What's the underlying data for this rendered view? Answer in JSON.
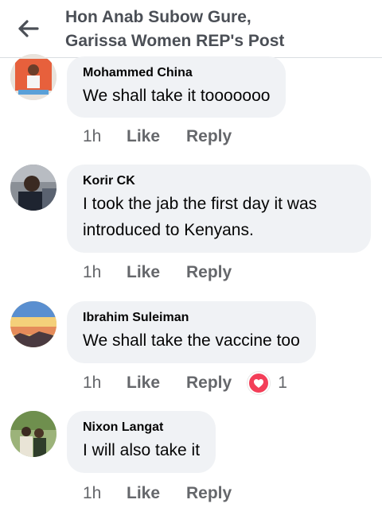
{
  "header": {
    "title_line1": "Hon Anab Subow Gure,",
    "title_line2": "Garissa Women REP's Post"
  },
  "comments": [
    {
      "author": "Mohammed China",
      "text": "We shall take it tooooooo",
      "time": "1h",
      "like_label": "Like",
      "reply_label": "Reply"
    },
    {
      "author": "Korir CK",
      "text_line1": "I took the jab the first day it was",
      "text_line2": "introduced to Kenyans.",
      "time": "1h",
      "like_label": "Like",
      "reply_label": "Reply"
    },
    {
      "author": "Ibrahim Suleiman",
      "text": "We shall take the vaccine too",
      "time": "1h",
      "like_label": "Like",
      "reply_label": "Reply",
      "reaction_icon": "heart-icon",
      "reaction_count": "1"
    },
    {
      "author": "Nixon Langat",
      "text": "I will also take it",
      "time": "1h",
      "like_label": "Like",
      "reply_label": "Reply"
    }
  ],
  "colors": {
    "bubble": "#f0f2f5",
    "meta": "#65676b",
    "reaction": "#f33e58"
  }
}
